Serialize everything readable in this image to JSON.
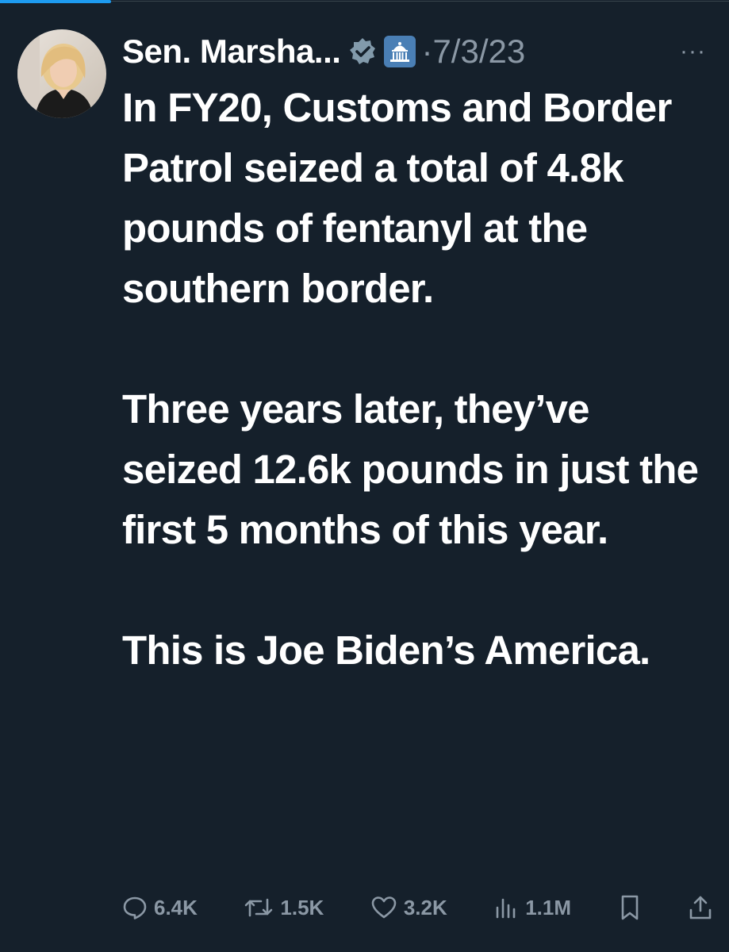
{
  "tweet": {
    "author_name": "Sen. Marsha...",
    "separator": "·",
    "date": "7/3/23",
    "more_label": "···",
    "paragraphs": [
      "In FY20, Customs and Border Patrol seized a total of 4.8k pounds of fentanyl at the southern border.",
      "Three years later, they’ve seized 12.6k pounds in just the first 5 months of this year.",
      "This is Joe Biden’s America."
    ]
  },
  "badges": {
    "verified_icon": "verified-badge-icon",
    "affiliation_icon": "government-building-icon"
  },
  "actions": {
    "replies": "6.4K",
    "reposts": "1.5K",
    "likes": "3.2K",
    "views": "1.1M"
  },
  "icons": {
    "reply": "reply-bubble-icon",
    "repost": "repost-arrows-icon",
    "like": "heart-icon",
    "views": "bar-chart-icon",
    "bookmark": "bookmark-icon",
    "share": "share-upload-icon"
  },
  "colors": {
    "background": "#15202b",
    "text": "#ffffff",
    "muted": "#8b98a5",
    "verified_badge": "#829aab",
    "affiliation_badge": "#4a7fb5",
    "accent": "#1d9bf0"
  }
}
